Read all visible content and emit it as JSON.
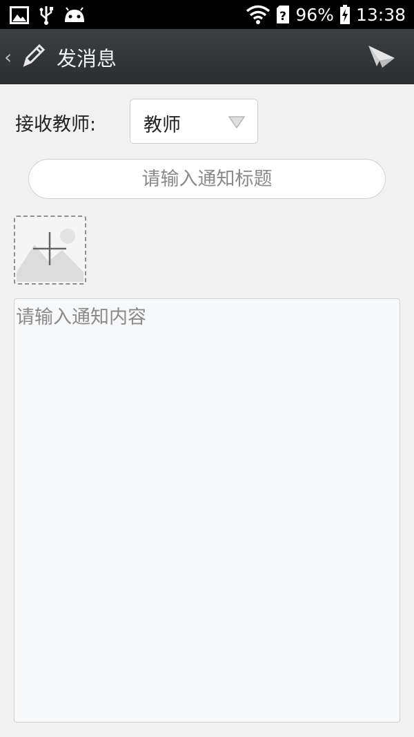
{
  "status_bar": {
    "icons": [
      "image-icon",
      "usb-icon",
      "android-icon",
      "wifi-icon",
      "sim-unknown-icon",
      "battery-charging-icon"
    ],
    "battery": "96%",
    "time": "13:38"
  },
  "toolbar": {
    "title": "发消息",
    "back_icon": "chevron-left-icon",
    "edit_icon": "pencil-icon",
    "send_icon": "paper-plane-icon"
  },
  "form": {
    "recipient_label": "接收教师:",
    "recipient_value": "教师",
    "title_placeholder": "请输入通知标题",
    "add_image_icon": "add-image-icon",
    "content_placeholder": "请输入通知内容"
  },
  "colors": {
    "toolbar_bg": "#323538",
    "page_bg": "#f1f1f1"
  }
}
